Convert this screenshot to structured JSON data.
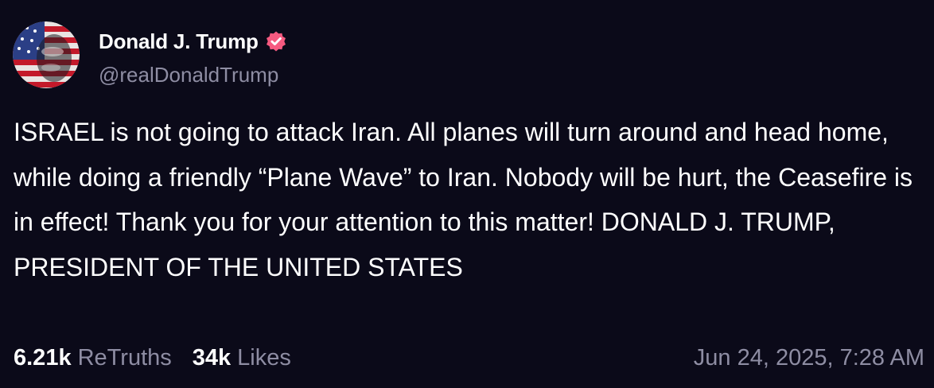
{
  "author": {
    "display_name": "Donald J. Trump",
    "handle": "@realDonaldTrump",
    "avatar_icon": "flag-portrait-avatar",
    "verified_icon": "verified-badge-icon",
    "verified_color": "#f65a80"
  },
  "post": {
    "text": "ISRAEL is not going to attack Iran. All planes will turn around and head home, while doing a friendly “Plane Wave” to Iran. Nobody will be hurt, the Ceasefire is in effect! Thank you for your attention to this matter! DONALD J. TRUMP, PRESIDENT OF THE UNITED STATES"
  },
  "stats": {
    "retruths_count": "6.21k",
    "retruths_label": "ReTruths",
    "likes_count": "34k",
    "likes_label": "Likes"
  },
  "timestamp": "Jun 24, 2025, 7:28 AM",
  "colors": {
    "background": "#0b0a19",
    "text": "#ffffff",
    "muted": "#8e8da3"
  }
}
